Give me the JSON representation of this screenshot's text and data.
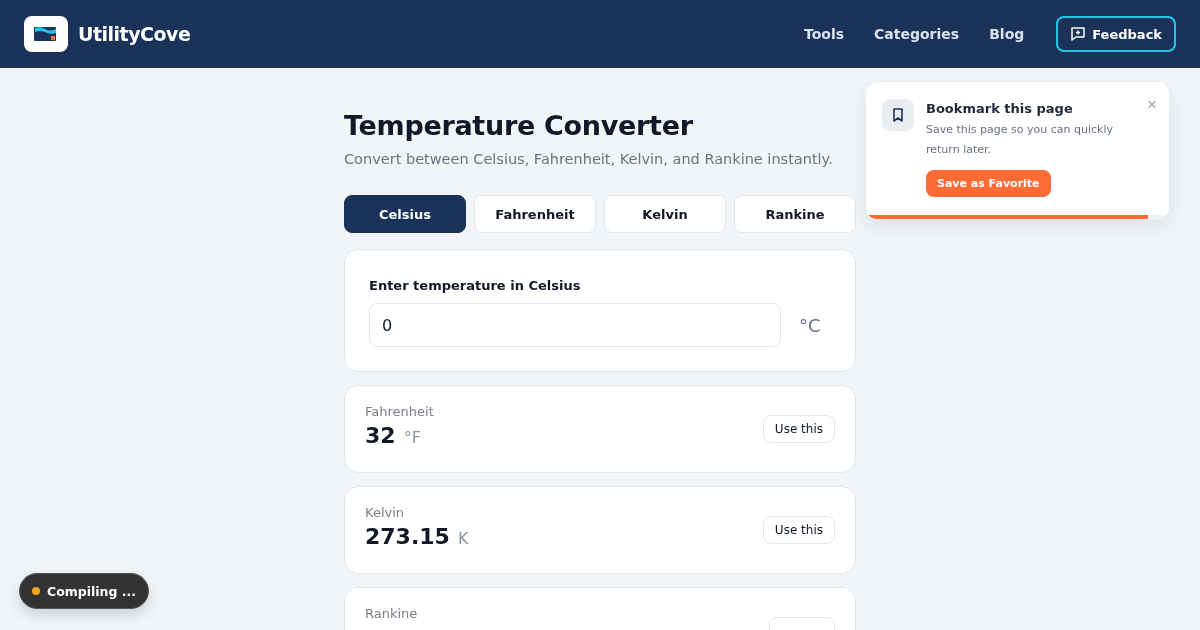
{
  "header": {
    "brand": "UtilityCove",
    "nav": [
      {
        "label": "Tools"
      },
      {
        "label": "Categories"
      },
      {
        "label": "Blog"
      }
    ],
    "feedback_button": "Feedback"
  },
  "page": {
    "title": "Temperature Converter",
    "subtitle": "Convert between Celsius, Fahrenheit, Kelvin, and Rankine instantly."
  },
  "tabs": [
    {
      "label": "Celsius",
      "selected": true
    },
    {
      "label": "Fahrenheit",
      "selected": false
    },
    {
      "label": "Kelvin",
      "selected": false
    },
    {
      "label": "Rankine",
      "selected": false
    }
  ],
  "input": {
    "label": "Enter temperature in Celsius",
    "value": "0",
    "unit": "°C"
  },
  "results": [
    {
      "name": "Fahrenheit",
      "value": "32",
      "unit": "°F",
      "button": "Use this"
    },
    {
      "name": "Kelvin",
      "value": "273.15",
      "unit": "K",
      "button": "Use this"
    },
    {
      "name": "Rankine"
    }
  ],
  "toast": {
    "title": "Bookmark this page",
    "message": "Save this page so you can quickly return later.",
    "button": "Save as Favorite",
    "close": "×",
    "level": 0.93
  },
  "status": {
    "label": "Compiling ...",
    "color": "#f5a623"
  }
}
